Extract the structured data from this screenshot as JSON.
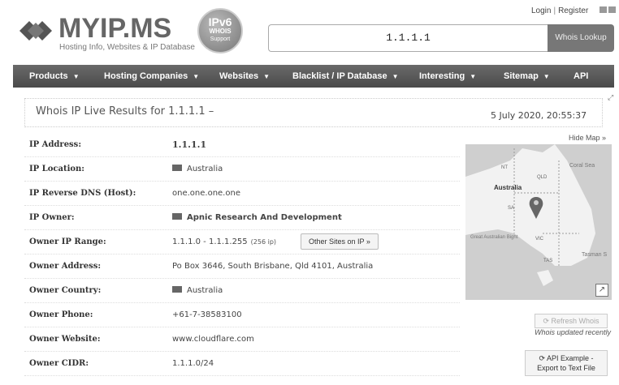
{
  "header": {
    "login": "Login",
    "register": "Register",
    "logo_title": "MYIP.MS",
    "logo_subtitle": "Hosting Info, Websites & IP Database",
    "badge_line1": "IPv6",
    "badge_line2": "WHOIS",
    "badge_line3": "Support",
    "search_value": "1.1.1.1",
    "search_button": "Whois Lookup"
  },
  "nav": {
    "items": [
      "Products",
      "Hosting Companies",
      "Websites",
      "Blacklist / IP Database",
      "Interesting",
      "Sitemap",
      "API"
    ]
  },
  "results": {
    "title": "Whois IP Live Results for 1.1.1.1 –",
    "date": "5 July 2020, 20:55:37",
    "hide_map": "Hide Map »",
    "rows": [
      {
        "label": "IP Address:",
        "value": "1.1.1.1"
      },
      {
        "label": "IP Location:",
        "value": "Australia"
      },
      {
        "label": "IP Reverse DNS (Host):",
        "value": "one.one.one.one"
      },
      {
        "label": "IP Owner:",
        "value": "Apnic Research And Development"
      },
      {
        "label": "Owner IP Range:",
        "value": "1.1.1.0 - 1.1.1.255",
        "count": "(256 ip)",
        "button": "Other Sites on IP »"
      },
      {
        "label": "Owner Address:",
        "value": "Po Box 3646, South Brisbane, Qld 4101, Australia"
      },
      {
        "label": "Owner Country:",
        "value": "Australia"
      },
      {
        "label": "Owner Phone:",
        "value": "+61-7-38583100"
      },
      {
        "label": "Owner Website:",
        "value": "www.cloudflare.com"
      },
      {
        "label": "Owner CIDR:",
        "value": "1.1.1.0/24"
      }
    ]
  },
  "map": {
    "labels": {
      "nt": "NT",
      "australia": "Australia",
      "qld": "QLD",
      "sa": "SA",
      "coral_sea": "Coral Sea",
      "bight": "Great Australian Bight",
      "vic": "VIC",
      "tasman": "Tasman S",
      "tas": "TAS"
    }
  },
  "sidebar": {
    "refresh": "Refresh Whois",
    "updated": "Whois updated recently",
    "api_line1": "API Example -",
    "api_line2": "Export to Text File"
  }
}
